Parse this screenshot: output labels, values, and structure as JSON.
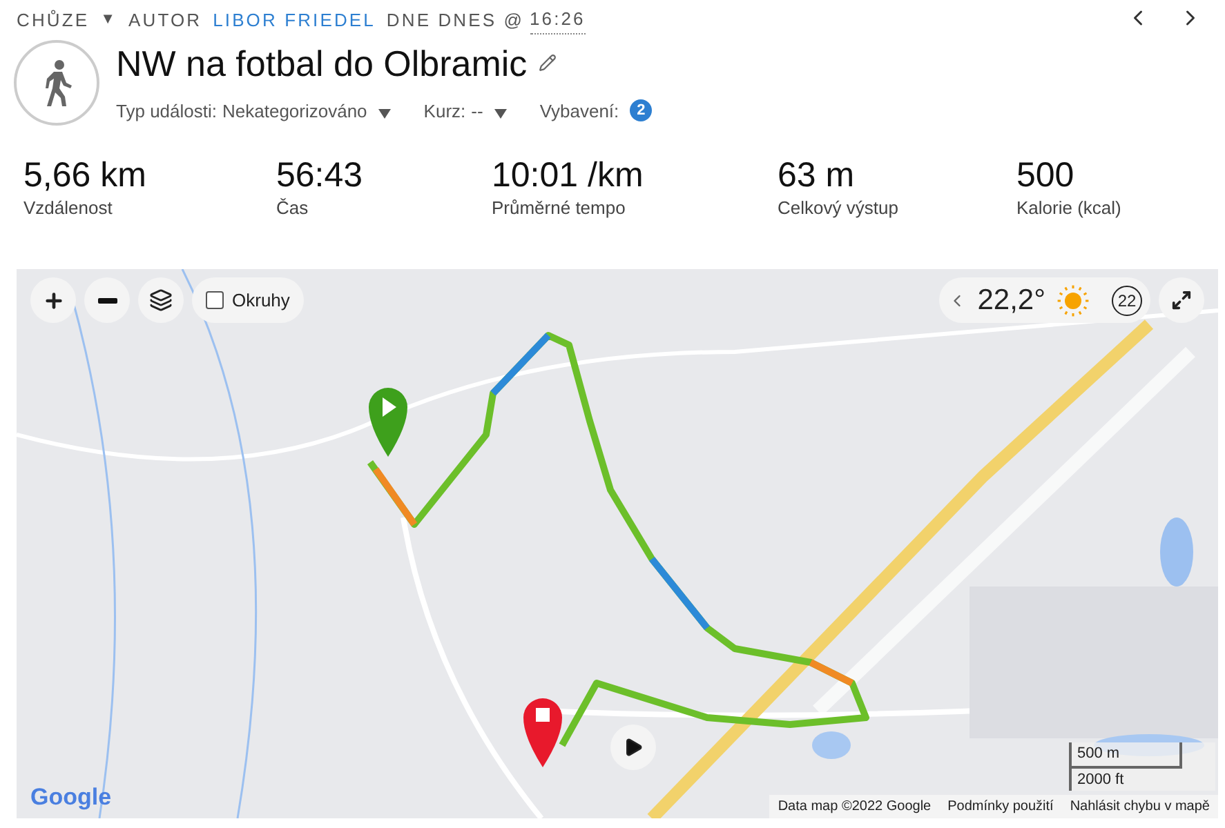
{
  "header": {
    "activity": "CHŮZE",
    "activity_caret": "▼",
    "author_prefix": "AUTOR",
    "author": "LIBOR FRIEDEL",
    "date_prefix": "DNE DNES @",
    "time": "16:26",
    "title": "NW na fotbal do Olbramic",
    "meta": [
      {
        "label": "Typ události:",
        "value": "Nekategorizováno",
        "kind": "dropdown"
      },
      {
        "label": "Kurz:",
        "value": "--",
        "kind": "dropdown"
      },
      {
        "label": "Vybavení:",
        "value": "2",
        "kind": "badge"
      }
    ]
  },
  "stats": [
    {
      "value": "5,66 km",
      "label": "Vzdálenost"
    },
    {
      "value": "56:43",
      "label": "Čas"
    },
    {
      "value": "10:01 /km",
      "label": "Průměrné tempo"
    },
    {
      "value": "63 m",
      "label": "Celkový výstup"
    },
    {
      "value": "500",
      "label": "Kalorie (kcal)"
    }
  ],
  "map": {
    "laps": {
      "label": "Okruhy",
      "checked": false
    },
    "weather": {
      "temperature": "22,2°",
      "wind": "22"
    },
    "scale": [
      "500 m",
      "2000 ft"
    ],
    "logo": "Google",
    "footer": [
      "Data map ©2022 Google",
      "Podmínky použití",
      "Nahlásit chybu v mapě"
    ]
  }
}
